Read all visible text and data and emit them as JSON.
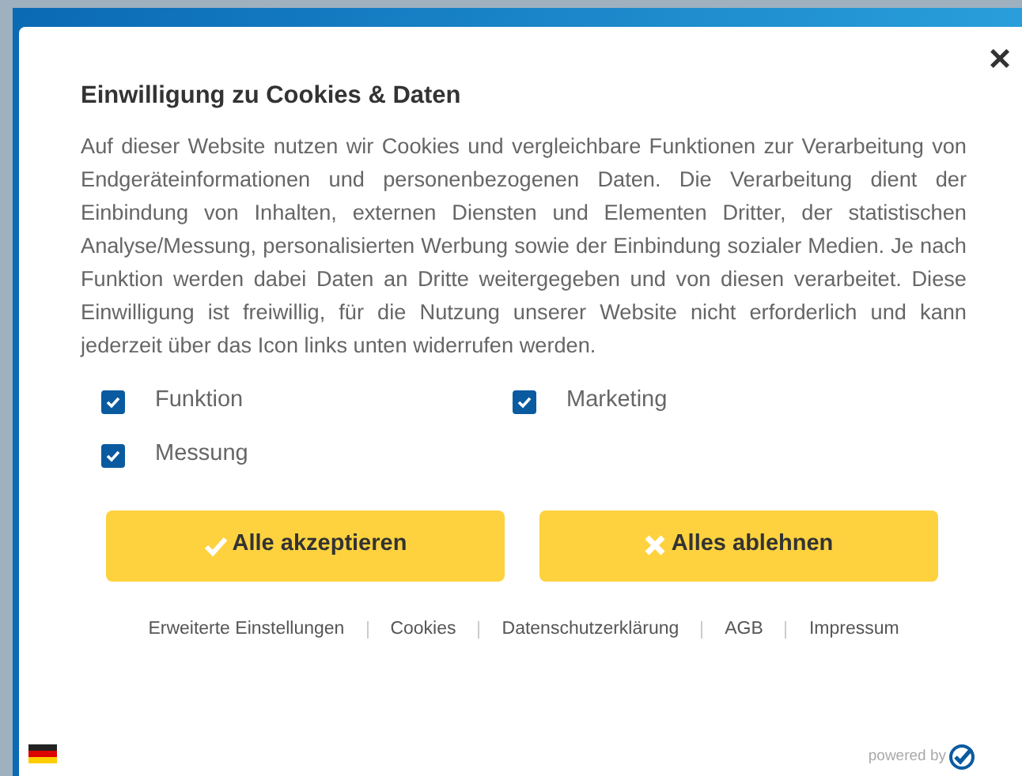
{
  "dialog": {
    "title": "Einwilligung zu Cookies & Daten",
    "close": "×",
    "text": "Auf dieser Website nutzen wir Cookies und vergleichbare Funktionen zur Verarbeitung von Endgeräteinformationen und personenbezogenen Daten. Die Verarbeitung dient der Einbindung von Inhalten, externen Diensten und Elementen Dritter, der statistischen Analyse/Messung, personalisierten Werbung sowie der Einbindung sozialer Medien. Je nach Funktion werden dabei Daten an Dritte weitergegeben und von diesen verarbeitet. Diese Einwilligung ist freiwillig, für die Nutzung unserer Website nicht erforderlich und kann jederzeit über das Icon links unten widerrufen werden.",
    "options": [
      {
        "label": "Funktion",
        "checked": true
      },
      {
        "label": "Marketing",
        "checked": true
      },
      {
        "label": "Messung",
        "checked": true
      }
    ],
    "buttons": [
      {
        "label": "Alle akzeptieren",
        "kind": "accept"
      },
      {
        "label": "Alles ablehnen",
        "kind": "reject"
      }
    ],
    "links": [
      "Erweiterte Einstellungen",
      "Cookies",
      "Datenschutzerklärung",
      "AGB",
      "Impressum"
    ],
    "powered_by": "powered by"
  }
}
